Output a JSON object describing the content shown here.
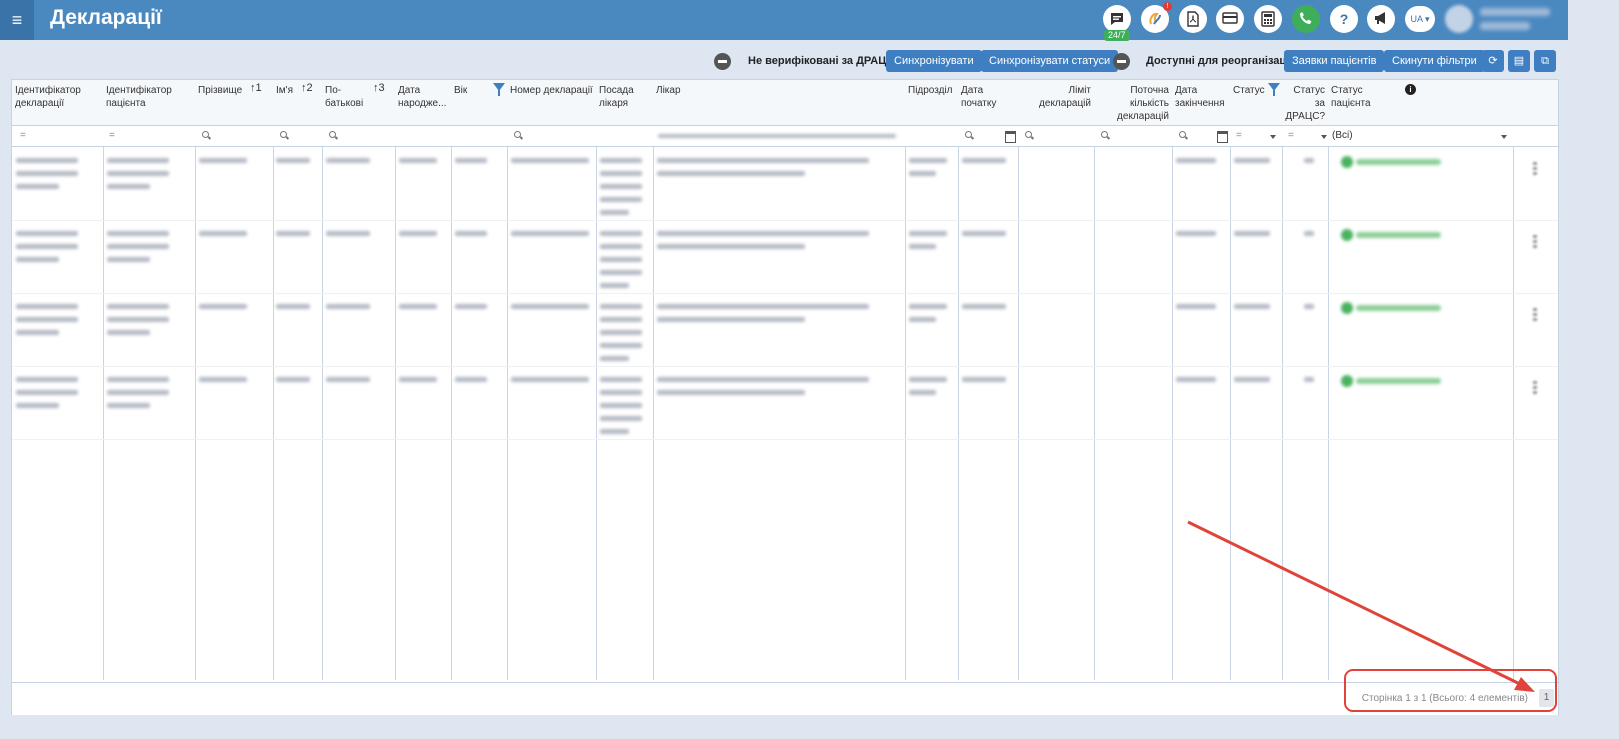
{
  "header": {
    "menu_icon": "hamburger-menu-icon",
    "title": "Декларації",
    "chat_badge": "24/7",
    "alert_badge": "!",
    "lang": "UA",
    "icons": [
      "chat-icon",
      "hands-logo-icon",
      "pdf-icon",
      "card-icon",
      "calculator-icon",
      "phone-icon",
      "help-icon",
      "megaphone-icon"
    ],
    "help_glyph": "?"
  },
  "toolbar": {
    "not_verified_label": "Не верифіковані за ДРАЦС",
    "sync_label": "Синхронізувати",
    "sync_status_label": "Синхронізувати статуси",
    "available_reorg_label": "Доступні для реорганізації",
    "patient_requests_label": "Заявки пацієнтів",
    "reset_filters_label": "Скинути фільтри",
    "refresh_icon": "⟳",
    "save_icon": "▤",
    "export_icon": "⧉"
  },
  "table": {
    "columns": {
      "decl_id": "Ідентифікатор декларації",
      "patient_id": "Ідентифікатор пацієнта",
      "surname": "Прізвище",
      "name": "Ім'я",
      "patronymic": "По-батькові",
      "birth_date": "Дата народже...",
      "age": "Вік",
      "decl_number": "Номер декларації",
      "doctor_position": "Посада лікаря",
      "doctor": "Лікар",
      "division": "Підрозділ",
      "start_date": "Дата початку",
      "limit": "Ліміт декларацій",
      "current_count": "Поточна кількість декларацій",
      "end_date": "Дата закінчення",
      "status": "Статус",
      "drats_status": "Статус за ДРАЦС?",
      "patient_status": "Статус пацієнта"
    },
    "sort_marks": {
      "surname": "1",
      "name": "2",
      "patronymic": "3"
    },
    "filters": {
      "equals": "=",
      "patient_status_value": "(Всі)"
    },
    "rows": [
      {
        "index": 1
      },
      {
        "index": 2
      },
      {
        "index": 3
      },
      {
        "index": 4
      }
    ]
  },
  "footer": {
    "pager_text": "Сторінка 1 з 1 (Всього: 4 елементів)",
    "page_number": "1"
  },
  "colors": {
    "topbar": "#4a88c0",
    "button": "#3f7fc1",
    "highlight": "#e0433a"
  }
}
